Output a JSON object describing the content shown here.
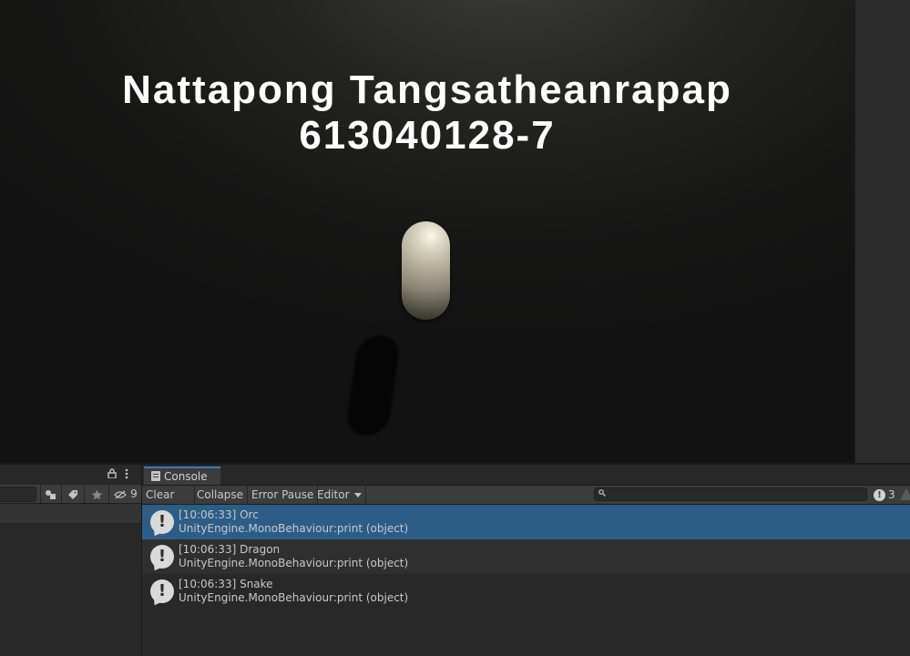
{
  "game_view": {
    "overlay_name": "Nattapong Tangsatheanrapap",
    "overlay_id": "613040128-7"
  },
  "left_panel": {
    "hidden_count": "9"
  },
  "console": {
    "tab_label": "Console",
    "toolbar": {
      "clear_label": "Clear",
      "collapse_label": "Collapse",
      "error_pause_label": "Error Pause",
      "editor_label": "Editor",
      "search_placeholder": "",
      "log_count": "3"
    },
    "entries": [
      {
        "line1": "[10:06:33] Orc",
        "line2": "UnityEngine.MonoBehaviour:print (object)",
        "selected": true
      },
      {
        "line1": "[10:06:33] Dragon",
        "line2": "UnityEngine.MonoBehaviour:print (object)",
        "selected": false
      },
      {
        "line1": "[10:06:33] Snake",
        "line2": "UnityEngine.MonoBehaviour:print (object)",
        "selected": false
      }
    ]
  },
  "colors": {
    "selection": "#2c5d87",
    "tab_accent": "#3a79bb",
    "panel_bg": "#282828",
    "toolbar_bg": "#3c3c3c"
  }
}
